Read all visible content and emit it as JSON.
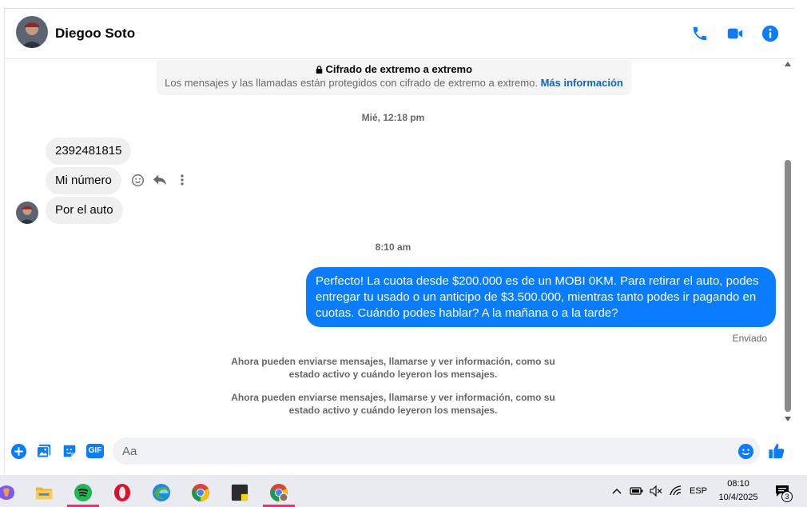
{
  "header": {
    "contact_name": "Diegoo Soto",
    "icons": [
      "phone-icon",
      "video-camera-icon",
      "info-icon"
    ]
  },
  "thread": {
    "encryption": {
      "title": "Cifrado de extremo a extremo",
      "text": "Los mensajes y las llamadas están protegidos con cifrado de extremo a extremo.",
      "link": "Más información"
    },
    "timestamp_1": "Mié, 12:18 pm",
    "incoming": [
      {
        "text": "2392481815"
      },
      {
        "text": "Mi número"
      },
      {
        "text": "Por el auto"
      }
    ],
    "timestamp_2": "8:10 am",
    "outgoing": {
      "text": "Perfecto! La cuota desde $200.000 es de un MOBI 0KM. Para retirar el auto, podes entregar tu usado o un anticipo de $3.500.000, mientras tanto podes ir pagando en cuotas. Cuándo podes hablar? A la mañana o a la tarde?",
      "status": "Enviado"
    },
    "system_messages": [
      "Ahora pueden enviarse mensajes, llamarse y ver información, como su estado activo y cuándo leyeron los mensajes.",
      "Ahora pueden enviarse mensajes, llamarse y ver información, como su estado activo y cuándo leyeron los mensajes."
    ]
  },
  "composer": {
    "placeholder": "Aa",
    "gif_label": "GIF",
    "icons": [
      "plus-circle-icon",
      "photo-icon",
      "sticker-icon",
      "gif-icon",
      "emoji-icon",
      "thumbs-up-icon"
    ]
  },
  "taskbar": {
    "apps": [
      "copilot-icon",
      "file-explorer-icon",
      "spotify-icon",
      "opera-icon",
      "edge-icon",
      "chrome-icon",
      "sticky-notes-icon",
      "chrome-profile-icon"
    ],
    "language": "ESP",
    "time": "08:10",
    "date": "10/4/2025",
    "notification_count": "3"
  },
  "colors": {
    "accent": "#0a7cff",
    "link": "#0a64d8",
    "bubble_in": "#f0f0f0",
    "muted_text": "#65676b"
  }
}
